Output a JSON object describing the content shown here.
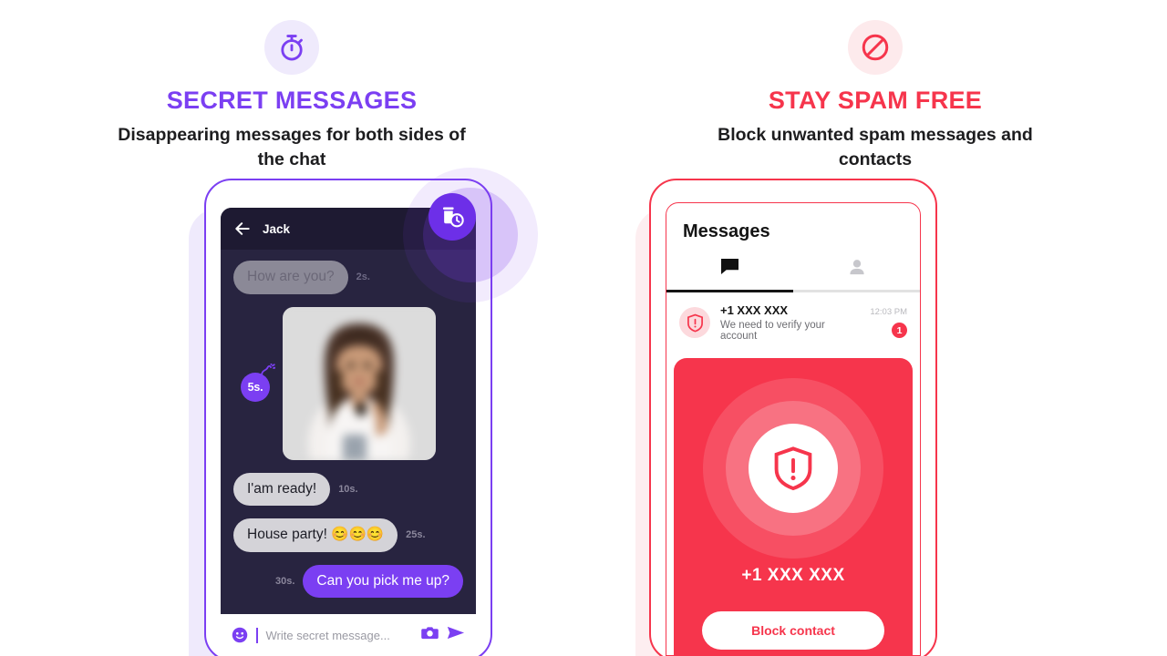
{
  "theme": {
    "purple": "#7b3ff2",
    "purple_dark": "#6d2fe8",
    "red": "#f6354c",
    "chat_bg": "#282440",
    "chat_topbar": "#1e1a32",
    "lavender": "#efeafc",
    "pink": "#fdeef0"
  },
  "left_panel": {
    "icon_name": "stopwatch-icon",
    "title": "SECRET MESSAGES",
    "subtitle": "Disappearing messages for both sides of the chat",
    "phone": {
      "topbar": {
        "back_icon": "back-arrow-icon",
        "contact_name": "Jack"
      },
      "fab": {
        "icon_name": "trash-clock-icon"
      },
      "messages": [
        {
          "id": "m1",
          "direction": "in",
          "type": "text",
          "text": "How are you?",
          "timer": "2s.",
          "state": "fading"
        },
        {
          "id": "m2",
          "direction": "in",
          "type": "image",
          "text": "",
          "timer": "5s.",
          "state": "normal",
          "timer_style": "bomb",
          "image_alt": "blurred photo of woman holding phone"
        },
        {
          "id": "m3",
          "direction": "in",
          "type": "text",
          "text": "I'am ready!",
          "timer": "10s.",
          "state": "normal"
        },
        {
          "id": "m4",
          "direction": "in",
          "type": "text",
          "text": "House party! 😊😊😊",
          "timer": "25s.",
          "state": "normal"
        },
        {
          "id": "m5",
          "direction": "out",
          "type": "text",
          "text": "Can you pick me up?",
          "timer": "30s.",
          "state": "normal"
        }
      ],
      "input_bar": {
        "emoji_icon": "smiley-icon",
        "placeholder": "Write secret message...",
        "camera_icon": "camera-icon",
        "send_icon": "send-icon"
      }
    }
  },
  "right_panel": {
    "icon_name": "block-circle-icon",
    "title": "STAY SPAM FREE",
    "subtitle": "Block unwanted spam messages and contacts",
    "phone": {
      "screen_title": "Messages",
      "tabs": [
        {
          "id": "chats",
          "icon_name": "chat-bubble-icon",
          "active": true
        },
        {
          "id": "contacts",
          "icon_name": "person-icon",
          "active": false
        }
      ],
      "conversation": {
        "icon_name": "shield-alert-icon",
        "name": "+1 XXX XXX",
        "preview": "We need to verify your account",
        "time": "12:03 PM",
        "unread": "1"
      },
      "block_card": {
        "icon_name": "shield-alert-icon",
        "number": "+1 XXX  XXX",
        "button_label": "Block contact"
      }
    }
  }
}
